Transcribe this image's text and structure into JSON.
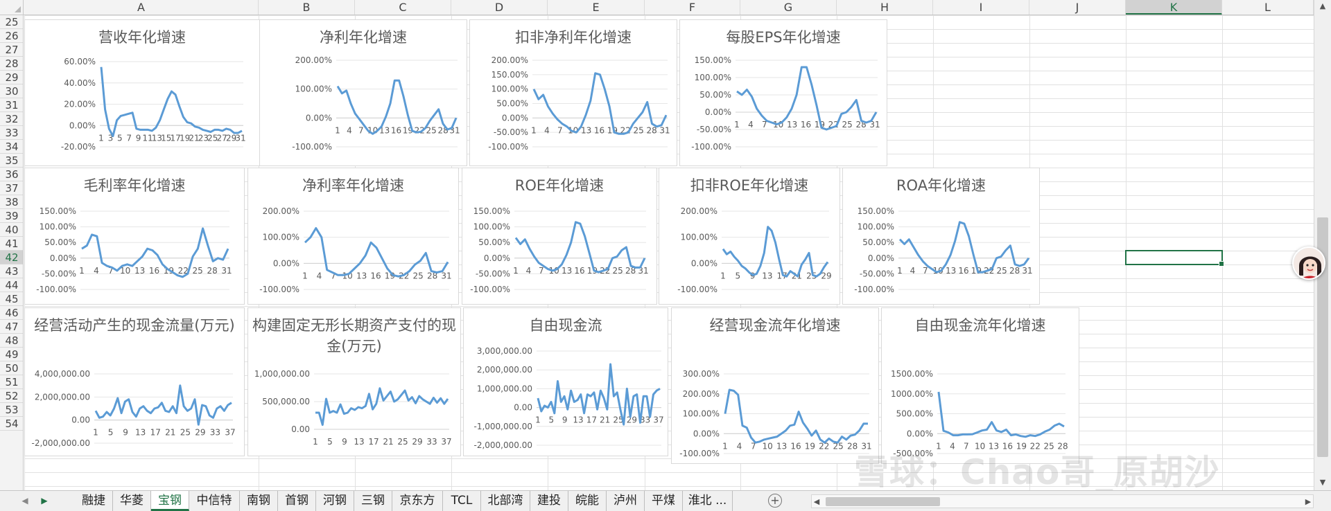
{
  "columns": [
    "A",
    "B",
    "C",
    "D",
    "E",
    "F",
    "G",
    "H",
    "I",
    "J",
    "K",
    "L"
  ],
  "rows": [
    "25",
    "26",
    "27",
    "28",
    "29",
    "30",
    "31",
    "32",
    "33",
    "34",
    "35",
    "36",
    "37",
    "38",
    "39",
    "40",
    "41",
    "42",
    "43",
    "44",
    "45",
    "46",
    "47",
    "48",
    "49",
    "50",
    "51",
    "52",
    "53",
    "54"
  ],
  "selected_column": "K",
  "selected_row": "42",
  "colors": {
    "accent": "#217346",
    "series": "#5b9bd5",
    "title": "#595959",
    "axis": "#595959"
  },
  "sheet_tabs": [
    "融捷",
    "华菱",
    "宝钢",
    "中信特",
    "南钢",
    "首钢",
    "河钢",
    "三钢",
    "京东方",
    "TCL",
    "北部湾",
    "建投",
    "皖能",
    "泸州",
    "平煤",
    "淮北 ..."
  ],
  "active_tab": "宝钢",
  "watermark": "雪球：Chao哥_原胡沙",
  "icons": {
    "add_sheet": "plus-circle-icon",
    "avatar": "avatar-icon"
  },
  "charts": [
    {
      "title": "营收年化增速",
      "y_ticks": [
        "60.00%",
        "40.00%",
        "20.00%",
        "0.00%",
        "-20.00%"
      ],
      "ylim": [
        -20,
        60
      ],
      "x_labels": [
        "1",
        "3",
        "5",
        "7",
        "9",
        "11",
        "13",
        "15",
        "17",
        "19",
        "21",
        "23",
        "25",
        "27",
        "29",
        "31"
      ],
      "values": [
        55,
        15,
        -3,
        -10,
        5,
        9,
        10,
        11,
        12,
        -3,
        -4,
        -4,
        -4,
        -5,
        -2,
        5,
        15,
        25,
        32,
        29,
        18,
        8,
        3,
        2,
        -1,
        -2,
        -4,
        -5,
        -6,
        -4,
        -4,
        -5,
        -3,
        -4,
        -7,
        -7,
        -5
      ]
    },
    {
      "title": "净利年化增速",
      "y_ticks": [
        "200.00%",
        "100.00%",
        "0.00%",
        "-100.00%"
      ],
      "ylim": [
        -100,
        200
      ],
      "x_labels": [
        "1",
        "4",
        "7",
        "10",
        "13",
        "16",
        "19",
        "22",
        "25",
        "28",
        "31"
      ],
      "values": [
        110,
        85,
        95,
        50,
        15,
        -5,
        -25,
        -45,
        -55,
        -45,
        -30,
        5,
        50,
        130,
        130,
        75,
        10,
        -45,
        -50,
        -48,
        -35,
        -10,
        10,
        30,
        -20,
        -40,
        -35,
        0
      ]
    },
    {
      "title": "扣非净利年化增速",
      "y_ticks": [
        "200.00%",
        "150.00%",
        "100.00%",
        "50.00%",
        "0.00%",
        "-50.00%",
        "-100.00%"
      ],
      "ylim": [
        -100,
        200
      ],
      "x_labels": [
        "1",
        "4",
        "7",
        "10",
        "13",
        "16",
        "19",
        "22",
        "25",
        "28",
        "31"
      ],
      "values": [
        100,
        65,
        80,
        40,
        15,
        -5,
        -20,
        -30,
        -45,
        -50,
        -30,
        10,
        60,
        155,
        150,
        100,
        40,
        -50,
        -55,
        -55,
        -50,
        -20,
        0,
        20,
        55,
        -20,
        -30,
        -25,
        10
      ]
    },
    {
      "title": "每股EPS年化增速",
      "y_ticks": [
        "150.00%",
        "100.00%",
        "50.00%",
        "0.00%",
        "-50.00%",
        "-100.00%"
      ],
      "ylim": [
        -100,
        150
      ],
      "x_labels": [
        "1",
        "4",
        "7",
        "10",
        "13",
        "16",
        "19",
        "22",
        "25",
        "28",
        "31"
      ],
      "values": [
        60,
        50,
        65,
        45,
        10,
        -10,
        -25,
        -30,
        -35,
        -30,
        -15,
        10,
        50,
        130,
        130,
        80,
        20,
        -45,
        -50,
        -45,
        -40,
        -5,
        0,
        15,
        35,
        -25,
        -30,
        -25,
        0
      ]
    },
    {
      "title": "毛利率年化增速",
      "y_ticks": [
        "150.00%",
        "100.00%",
        "50.00%",
        "0.00%",
        "-50.00%",
        "-100.00%"
      ],
      "ylim": [
        -100,
        150
      ],
      "x_labels": [
        "1",
        "4",
        "7",
        "10",
        "13",
        "16",
        "19",
        "22",
        "25",
        "28",
        "31"
      ],
      "values": [
        30,
        40,
        75,
        70,
        -15,
        -25,
        -30,
        -40,
        -25,
        -20,
        -25,
        -10,
        5,
        30,
        25,
        10,
        -20,
        -35,
        -45,
        -55,
        -60,
        -50,
        5,
        30,
        95,
        40,
        -10,
        0,
        -5,
        30
      ]
    },
    {
      "title": "净利率年化增速",
      "y_ticks": [
        "200.00%",
        "100.00%",
        "0.00%",
        "-100.00%"
      ],
      "ylim": [
        -100,
        200
      ],
      "x_labels": [
        "1",
        "4",
        "7",
        "10",
        "13",
        "16",
        "19",
        "22",
        "25",
        "28",
        "31"
      ],
      "values": [
        80,
        100,
        135,
        100,
        -25,
        -35,
        -45,
        -45,
        -40,
        -20,
        0,
        30,
        80,
        60,
        20,
        -20,
        -45,
        -50,
        -45,
        -30,
        -5,
        10,
        40,
        -30,
        -35,
        -30,
        5
      ]
    },
    {
      "title": "ROE年化增速",
      "y_ticks": [
        "150.00%",
        "100.00%",
        "50.00%",
        "0.00%",
        "-50.00%",
        "-100.00%"
      ],
      "ylim": [
        -100,
        150
      ],
      "x_labels": [
        "1",
        "4",
        "7",
        "10",
        "13",
        "16",
        "19",
        "22",
        "25",
        "28",
        "31"
      ],
      "values": [
        65,
        45,
        60,
        30,
        5,
        -15,
        -25,
        -35,
        -40,
        -35,
        -20,
        10,
        50,
        115,
        110,
        70,
        15,
        -40,
        -45,
        -40,
        -35,
        0,
        5,
        25,
        35,
        -25,
        -30,
        -30,
        0
      ]
    },
    {
      "title": "扣非ROE年化增速",
      "y_ticks": [
        "200.00%",
        "100.00%",
        "0.00%",
        "-100.00%"
      ],
      "ylim": [
        -100,
        200
      ],
      "x_labels": [
        "1",
        "5",
        "9",
        "13",
        "17",
        "21",
        "25",
        "29"
      ],
      "values": [
        55,
        35,
        45,
        25,
        10,
        -10,
        -20,
        -35,
        -45,
        -40,
        -10,
        40,
        140,
        125,
        80,
        15,
        -45,
        -50,
        -30,
        -40,
        -50,
        -5,
        15,
        40,
        -45,
        -50,
        -40,
        -15,
        5
      ]
    },
    {
      "title": "ROA年化增速",
      "y_ticks": [
        "150.00%",
        "100.00%",
        "50.00%",
        "0.00%",
        "-50.00%",
        "-100.00%"
      ],
      "ylim": [
        -100,
        150
      ],
      "x_labels": [
        "1",
        "4",
        "7",
        "10",
        "13",
        "16",
        "19",
        "22",
        "25",
        "28",
        "31"
      ],
      "values": [
        60,
        45,
        60,
        35,
        10,
        -10,
        -25,
        -35,
        -45,
        -40,
        -20,
        10,
        55,
        115,
        110,
        70,
        10,
        -45,
        -45,
        -40,
        -35,
        0,
        5,
        25,
        40,
        -20,
        -25,
        -20,
        0
      ]
    },
    {
      "title": "经营活动产生的现金流量(万元)",
      "y_ticks": [
        "4,000,000.00",
        "2,000,000.00",
        "0.00",
        "-2,000,000.00"
      ],
      "ylim": [
        -2000000,
        4000000
      ],
      "x_labels": [
        "1",
        "5",
        "9",
        "13",
        "17",
        "21",
        "25",
        "29",
        "33",
        "37"
      ],
      "values": [
        800000,
        200000,
        300000,
        700000,
        400000,
        1000000,
        1900000,
        600000,
        1600000,
        1800000,
        700000,
        300000,
        1000000,
        1200000,
        800000,
        600000,
        1000000,
        1100000,
        1500000,
        800000,
        700000,
        1200000,
        600000,
        3000000,
        1200000,
        800000,
        1000000,
        1800000,
        -400000,
        1300000,
        1200000,
        400000,
        200000,
        1000000,
        1200000,
        800000,
        1300000,
        1500000
      ]
    },
    {
      "title": "构建固定无形长期资产支付的现金(万元)",
      "y_ticks": [
        "1,000,000.00",
        "500,000.00",
        "0.00"
      ],
      "ylim": [
        0,
        1000000
      ],
      "x_labels": [
        "1",
        "5",
        "9",
        "13",
        "17",
        "21",
        "25",
        "29",
        "33",
        "37"
      ],
      "values": [
        300000,
        300000,
        80000,
        550000,
        300000,
        330000,
        300000,
        450000,
        280000,
        300000,
        380000,
        350000,
        400000,
        380000,
        420000,
        640000,
        360000,
        460000,
        740000,
        520000,
        600000,
        680000,
        500000,
        540000,
        620000,
        700000,
        520000,
        580000,
        470000,
        600000,
        540000,
        500000,
        460000,
        570000,
        480000,
        560000,
        460000,
        550000
      ]
    },
    {
      "title": "自由现金流",
      "y_ticks": [
        "3,000,000.00",
        "2,000,000.00",
        "1,000,000.00",
        "0.00",
        "-1,000,000.00",
        "-2,000,000.00"
      ],
      "ylim": [
        -2000000,
        3000000
      ],
      "x_labels": [
        "1",
        "5",
        "9",
        "13",
        "17",
        "21",
        "25",
        "29",
        "33",
        "37"
      ],
      "values": [
        500000,
        -200000,
        100000,
        0,
        300000,
        -300000,
        1400000,
        300000,
        600000,
        -100000,
        900000,
        300000,
        400000,
        700000,
        -300000,
        700000,
        600000,
        800000,
        -100000,
        900000,
        500000,
        -100000,
        2300000,
        600000,
        800000,
        -100000,
        -900000,
        1000000,
        -500000,
        600000,
        700000,
        -800000,
        600000,
        600000,
        -500000,
        700000,
        900000,
        1000000
      ]
    },
    {
      "title": "经营现金流年化增速",
      "y_ticks": [
        "300.00%",
        "200.00%",
        "100.00%",
        "0.00%",
        "-100.00%"
      ],
      "ylim": [
        -100,
        300
      ],
      "x_labels": [
        "1",
        "4",
        "7",
        "10",
        "13",
        "16",
        "19",
        "22",
        "25",
        "28",
        "31"
      ],
      "values": [
        100,
        220,
        215,
        195,
        40,
        30,
        -20,
        -45,
        -40,
        -30,
        -25,
        -20,
        -15,
        0,
        15,
        40,
        45,
        110,
        55,
        25,
        -10,
        15,
        -30,
        -45,
        -25,
        -40,
        -45,
        -15,
        -30,
        -10,
        -5,
        15,
        50,
        50
      ]
    },
    {
      "title": "自由现金流年化增速",
      "y_ticks": [
        "1500.00%",
        "1000.00%",
        "500.00%",
        "0.00%",
        "-500.00%"
      ],
      "ylim": [
        -500,
        1500
      ],
      "x_labels": [
        "1",
        "4",
        "7",
        "10",
        "13",
        "16",
        "19",
        "22",
        "25",
        "28"
      ],
      "values": [
        1050,
        70,
        30,
        -40,
        -40,
        -20,
        -20,
        -15,
        30,
        80,
        100,
        290,
        80,
        40,
        100,
        -40,
        -20,
        -60,
        -80,
        -40,
        -60,
        -20,
        50,
        100,
        200,
        250,
        180
      ]
    }
  ]
}
